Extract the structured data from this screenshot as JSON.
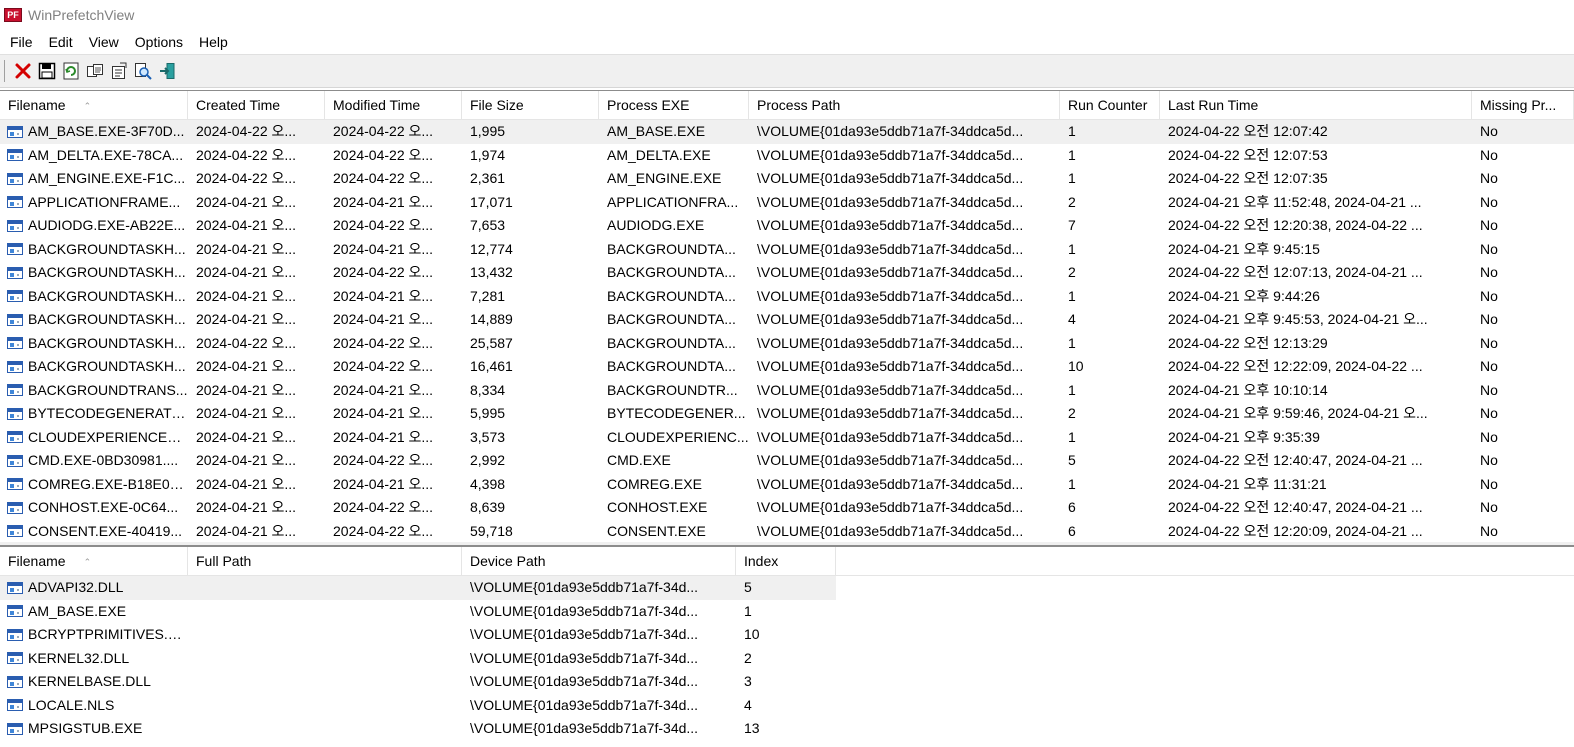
{
  "window": {
    "title": "WinPrefetchView",
    "icon_text": "PF"
  },
  "menu": [
    "File",
    "Edit",
    "View",
    "Options",
    "Help"
  ],
  "toolbar": [
    {
      "name": "delete-icon",
      "glyph": "✕",
      "color": "#d40000"
    },
    {
      "name": "save-icon",
      "glyph": "💾",
      "color": "#000"
    },
    {
      "name": "refresh-icon",
      "glyph": "⟳",
      "color": "#2a8a2a"
    },
    {
      "name": "copy-icon",
      "glyph": "⎘",
      "color": "#333"
    },
    {
      "name": "properties-icon",
      "glyph": "☰",
      "color": "#333"
    },
    {
      "name": "find-icon",
      "glyph": "🔍",
      "color": "#1a5fb4"
    },
    {
      "name": "exit-icon",
      "glyph": "⇥",
      "color": "#1a8a8a"
    }
  ],
  "top_table": {
    "columns": [
      "Filename",
      "Created Time",
      "Modified Time",
      "File Size",
      "Process EXE",
      "Process Path",
      "Run Counter",
      "Last Run Time",
      "Missing Pr..."
    ],
    "sort_indicator": "⌃",
    "rows": [
      [
        "AM_BASE.EXE-3F70D...",
        "2024-04-22 오...",
        "2024-04-22 오...",
        "1,995",
        "AM_BASE.EXE",
        "\\VOLUME{01da93e5ddb71a7f-34ddca5d...",
        "1",
        "2024-04-22 오전 12:07:42",
        "No"
      ],
      [
        "AM_DELTA.EXE-78CA...",
        "2024-04-22 오...",
        "2024-04-22 오...",
        "1,974",
        "AM_DELTA.EXE",
        "\\VOLUME{01da93e5ddb71a7f-34ddca5d...",
        "1",
        "2024-04-22 오전 12:07:53",
        "No"
      ],
      [
        "AM_ENGINE.EXE-F1C...",
        "2024-04-22 오...",
        "2024-04-22 오...",
        "2,361",
        "AM_ENGINE.EXE",
        "\\VOLUME{01da93e5ddb71a7f-34ddca5d...",
        "1",
        "2024-04-22 오전 12:07:35",
        "No"
      ],
      [
        "APPLICATIONFRAME...",
        "2024-04-21 오...",
        "2024-04-21 오...",
        "17,071",
        "APPLICATIONFRA...",
        "\\VOLUME{01da93e5ddb71a7f-34ddca5d...",
        "2",
        "2024-04-21 오후 11:52:48, 2024-04-21 ...",
        "No"
      ],
      [
        "AUDIODG.EXE-AB22E...",
        "2024-04-21 오...",
        "2024-04-22 오...",
        "7,653",
        "AUDIODG.EXE",
        "\\VOLUME{01da93e5ddb71a7f-34ddca5d...",
        "7",
        "2024-04-22 오전 12:20:38, 2024-04-22 ...",
        "No"
      ],
      [
        "BACKGROUNDTASKH...",
        "2024-04-21 오...",
        "2024-04-21 오...",
        "12,774",
        "BACKGROUNDTA...",
        "\\VOLUME{01da93e5ddb71a7f-34ddca5d...",
        "1",
        "2024-04-21 오후 9:45:15",
        "No"
      ],
      [
        "BACKGROUNDTASKH...",
        "2024-04-21 오...",
        "2024-04-22 오...",
        "13,432",
        "BACKGROUNDTA...",
        "\\VOLUME{01da93e5ddb71a7f-34ddca5d...",
        "2",
        "2024-04-22 오전 12:07:13, 2024-04-21 ...",
        "No"
      ],
      [
        "BACKGROUNDTASKH...",
        "2024-04-21 오...",
        "2024-04-21 오...",
        "7,281",
        "BACKGROUNDTA...",
        "\\VOLUME{01da93e5ddb71a7f-34ddca5d...",
        "1",
        "2024-04-21 오후 9:44:26",
        "No"
      ],
      [
        "BACKGROUNDTASKH...",
        "2024-04-21 오...",
        "2024-04-21 오...",
        "14,889",
        "BACKGROUNDTA...",
        "\\VOLUME{01da93e5ddb71a7f-34ddca5d...",
        "4",
        "2024-04-21 오후 9:45:53, 2024-04-21 오...",
        "No"
      ],
      [
        "BACKGROUNDTASKH...",
        "2024-04-22 오...",
        "2024-04-22 오...",
        "25,587",
        "BACKGROUNDTA...",
        "\\VOLUME{01da93e5ddb71a7f-34ddca5d...",
        "1",
        "2024-04-22 오전 12:13:29",
        "No"
      ],
      [
        "BACKGROUNDTASKH...",
        "2024-04-21 오...",
        "2024-04-22 오...",
        "16,461",
        "BACKGROUNDTA...",
        "\\VOLUME{01da93e5ddb71a7f-34ddca5d...",
        "10",
        "2024-04-22 오전 12:22:09, 2024-04-22 ...",
        "No"
      ],
      [
        "BACKGROUNDTRANS...",
        "2024-04-21 오...",
        "2024-04-21 오...",
        "8,334",
        "BACKGROUNDTR...",
        "\\VOLUME{01da93e5ddb71a7f-34ddca5d...",
        "1",
        "2024-04-21 오후 10:10:14",
        "No"
      ],
      [
        "BYTECODEGENERATO...",
        "2024-04-21 오...",
        "2024-04-21 오...",
        "5,995",
        "BYTECODEGENER...",
        "\\VOLUME{01da93e5ddb71a7f-34ddca5d...",
        "2",
        "2024-04-21 오후 9:59:46, 2024-04-21 오...",
        "No"
      ],
      [
        "CLOUDEXPERIENCEH...",
        "2024-04-21 오...",
        "2024-04-21 오...",
        "3,573",
        "CLOUDEXPERIENC...",
        "\\VOLUME{01da93e5ddb71a7f-34ddca5d...",
        "1",
        "2024-04-21 오후 9:35:39",
        "No"
      ],
      [
        "CMD.EXE-0BD30981....",
        "2024-04-21 오...",
        "2024-04-22 오...",
        "2,992",
        "CMD.EXE",
        "\\VOLUME{01da93e5ddb71a7f-34ddca5d...",
        "5",
        "2024-04-22 오전 12:40:47, 2024-04-21 ...",
        "No"
      ],
      [
        "COMREG.EXE-B18E07...",
        "2024-04-21 오...",
        "2024-04-21 오...",
        "4,398",
        "COMREG.EXE",
        "\\VOLUME{01da93e5ddb71a7f-34ddca5d...",
        "1",
        "2024-04-21 오후 11:31:21",
        "No"
      ],
      [
        "CONHOST.EXE-0C64...",
        "2024-04-21 오...",
        "2024-04-22 오...",
        "8,639",
        "CONHOST.EXE",
        "\\VOLUME{01da93e5ddb71a7f-34ddca5d...",
        "6",
        "2024-04-22 오전 12:40:47, 2024-04-21 ...",
        "No"
      ],
      [
        "CONSENT.EXE-40419...",
        "2024-04-21 오...",
        "2024-04-22 오...",
        "59,718",
        "CONSENT.EXE",
        "\\VOLUME{01da93e5ddb71a7f-34ddca5d...",
        "6",
        "2024-04-22 오전 12:20:09, 2024-04-21 ...",
        "No"
      ]
    ]
  },
  "bottom_table": {
    "columns": [
      "Filename",
      "Full Path",
      "Device Path",
      "Index"
    ],
    "sort_indicator": "⌃",
    "rows": [
      [
        "ADVAPI32.DLL",
        "",
        "\\VOLUME{01da93e5ddb71a7f-34d...",
        "5"
      ],
      [
        "AM_BASE.EXE",
        "",
        "\\VOLUME{01da93e5ddb71a7f-34d...",
        "1"
      ],
      [
        "BCRYPTPRIMITIVES.D...",
        "",
        "\\VOLUME{01da93e5ddb71a7f-34d...",
        "10"
      ],
      [
        "KERNEL32.DLL",
        "",
        "\\VOLUME{01da93e5ddb71a7f-34d...",
        "2"
      ],
      [
        "KERNELBASE.DLL",
        "",
        "\\VOLUME{01da93e5ddb71a7f-34d...",
        "3"
      ],
      [
        "LOCALE.NLS",
        "",
        "\\VOLUME{01da93e5ddb71a7f-34d...",
        "4"
      ],
      [
        "MPSIGSTUB.EXE",
        "",
        "\\VOLUME{01da93e5ddb71a7f-34d...",
        "13"
      ]
    ]
  }
}
